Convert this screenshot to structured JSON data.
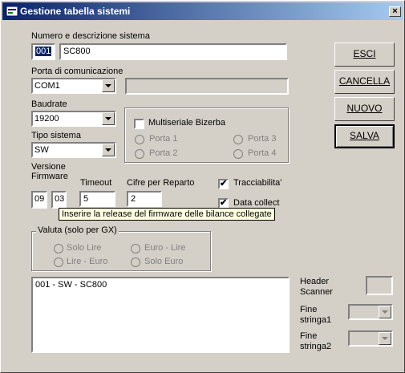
{
  "window": {
    "title": "Gestione tabella sistemi",
    "close_glyph": "×"
  },
  "numero": {
    "label": "Numero e descrizione sistema",
    "code": "001",
    "description": "SC800"
  },
  "porta": {
    "label": "Porta di comunicazione",
    "value": "COM1",
    "extra_value": ""
  },
  "baudrate": {
    "label": "Baudrate",
    "value": "19200"
  },
  "tipo": {
    "label": "Tipo sistema",
    "value": "SW"
  },
  "multiseriale": {
    "label": "Multiseriale Bizerba",
    "checked": false,
    "ports": [
      "Porta 1",
      "Porta 2",
      "Porta 3",
      "Porta 4"
    ]
  },
  "versione": {
    "label_line1": "Versione",
    "label_line2": "Firmware",
    "major": "09",
    "minor": "03"
  },
  "timeout": {
    "label": "Timeout",
    "value": "5"
  },
  "cifre": {
    "label": "Cifre per Reparto",
    "value": "2"
  },
  "tracciabilita": {
    "label": "Tracciabilita'",
    "checked": true,
    "mark": "✔"
  },
  "data_collect": {
    "label": "Data collect",
    "checked": true,
    "mark": "✔"
  },
  "tooltip": {
    "text": "Inserire la release del firmware delle bilance collegate"
  },
  "valuta": {
    "title": "Valuta (solo per GX)",
    "options": [
      "Solo Lire",
      "Euro - Lire",
      "Lire - Euro",
      "Solo Euro"
    ]
  },
  "list": {
    "items": [
      "001 - SW - SC800"
    ]
  },
  "header_scanner": {
    "label_line1": "Header",
    "label_line2": "Scanner",
    "value": ""
  },
  "fine_stringa1": {
    "label_line1": "Fine",
    "label_line2": "stringa1",
    "value": ""
  },
  "fine_stringa2": {
    "label_line1": "Fine",
    "label_line2": "stringa2",
    "value": ""
  },
  "buttons": {
    "esci": "ESCI",
    "cancella": "CANCELLA",
    "nuovo": "NUOVO",
    "salva": "SALVA"
  },
  "colors": {
    "titlebar_start": "#0a246a",
    "titlebar_end": "#a6caf0",
    "face": "#d4d0c8",
    "tooltip_bg": "#ffffe1"
  },
  "icons": {
    "app": "app-icon",
    "close": "close-icon",
    "dropdown": "chevron-down-icon"
  }
}
